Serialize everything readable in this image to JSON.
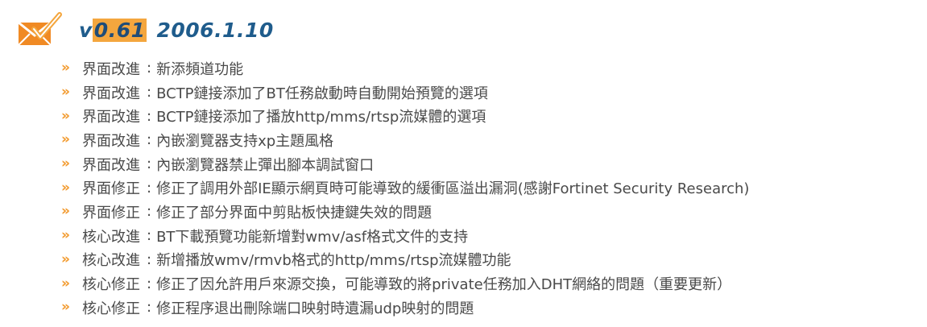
{
  "header": {
    "icon": "envelope-check-icon",
    "version_prefix": "v",
    "version_number": "0.61",
    "date": "2006.1.10"
  },
  "bullet_glyph": "»",
  "separator": ":",
  "items": [
    {
      "category": "界面改進",
      "text": "新添頻道功能"
    },
    {
      "category": "界面改進",
      "text": "BCTP鏈接添加了BT任務啟動時自動開始預覽的選項"
    },
    {
      "category": "界面改進",
      "text": "BCTP鏈接添加了播放http/mms/rtsp流媒體的選項"
    },
    {
      "category": "界面改進",
      "text": "內嵌瀏覽器支持xp主題風格"
    },
    {
      "category": "界面改進",
      "text": "內嵌瀏覽器禁止彈出腳本調試窗口"
    },
    {
      "category": "界面修正",
      "text": "修正了調用外部IE顯示網頁時可能導致的緩衝區溢出漏洞(感謝Fortinet Security Research)"
    },
    {
      "category": "界面修正",
      "text": "修正了部分界面中剪貼板快捷鍵失效的問題"
    },
    {
      "category": "核心改進",
      "text": "BT下載預覽功能新增對wmv/asf格式文件的支持"
    },
    {
      "category": "核心改進",
      "text": "新增播放wmv/rmvb格式的http/mms/rtsp流媒體功能"
    },
    {
      "category": "核心修正",
      "text": "修正了因允許用戶來源交換，可能導致的將private任務加入DHT網絡的問題（重要更新）"
    },
    {
      "category": "核心修正",
      "text": "修正程序退出刪除端口映射時遺漏udp映射的問題"
    }
  ],
  "colors": {
    "accent_orange": "#f4a63e",
    "heading_blue": "#1f5c8c",
    "text_gray": "#4a4a4a"
  }
}
